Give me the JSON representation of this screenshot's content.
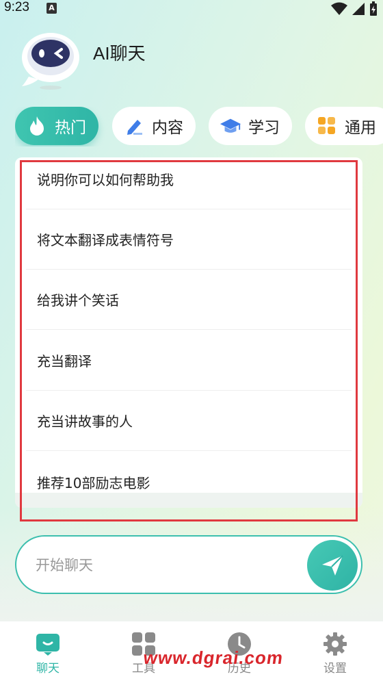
{
  "status_bar": {
    "time": "9:23",
    "notification_letter": "A"
  },
  "header": {
    "title": "AI聊天"
  },
  "tabs": [
    {
      "label": "热门",
      "icon": "flame-icon",
      "active": true
    },
    {
      "label": "内容",
      "icon": "pen-icon",
      "active": false
    },
    {
      "label": "学习",
      "icon": "graduation-cap-icon",
      "active": false
    },
    {
      "label": "通用",
      "icon": "grid-icon",
      "active": false
    }
  ],
  "prompts": [
    "说明你可以如何帮助我",
    "将文本翻译成表情符号",
    "给我讲个笑话",
    "充当翻译",
    "充当讲故事的人",
    "推荐10部励志电影"
  ],
  "chat_input": {
    "placeholder": "开始聊天"
  },
  "nav": [
    {
      "label": "聊天",
      "icon": "chat-icon",
      "active": true
    },
    {
      "label": "工具",
      "icon": "tools-grid-icon",
      "active": false
    },
    {
      "label": "历史",
      "icon": "clock-icon",
      "active": false
    },
    {
      "label": "设置",
      "icon": "gear-icon",
      "active": false
    }
  ],
  "watermark": "www.dgrai.com",
  "colors": {
    "accent": "#2fb5a6",
    "highlight": "#e0393f",
    "watermark": "#d9262c"
  }
}
